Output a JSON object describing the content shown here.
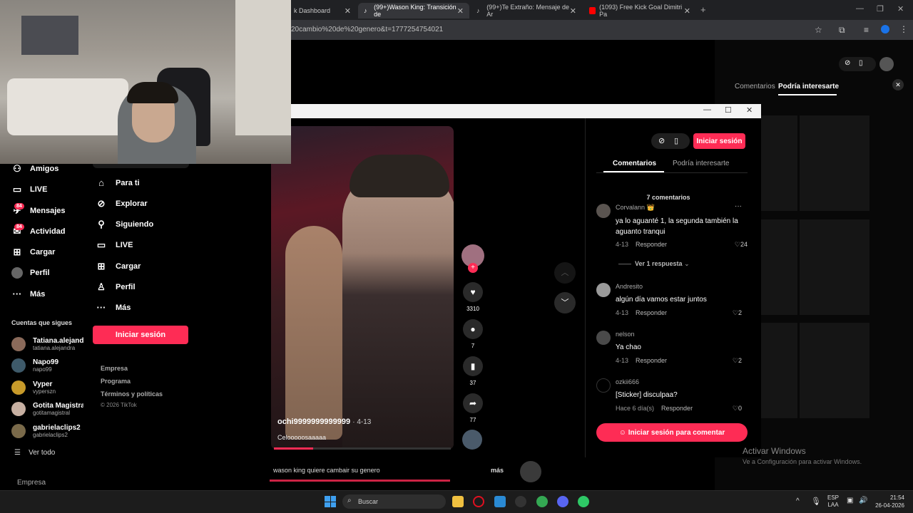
{
  "browser": {
    "tabs": [
      {
        "label": "k Dashboard"
      },
      {
        "label": "(99+)Wason King: Transición de"
      },
      {
        "label": "(99+)Te Extraño: Mensaje de Ar"
      },
      {
        "label": "(1093) Free Kick Goal Dimitri Pa"
      }
    ],
    "url": "20cambio%20de%20genero&t=1777254754021"
  },
  "sidebar": {
    "items": [
      {
        "label": "Amigos",
        "icon": "friends-icon"
      },
      {
        "label": "LIVE",
        "icon": "live-icon"
      },
      {
        "label": "Mensajes",
        "icon": "messages-icon",
        "badge": "84"
      },
      {
        "label": "Actividad",
        "icon": "activity-icon",
        "badge": "84"
      },
      {
        "label": "Cargar",
        "icon": "upload-icon"
      },
      {
        "label": "Perfil",
        "icon": "profile-icon"
      },
      {
        "label": "Más",
        "icon": "more-icon"
      }
    ],
    "following_title": "Cuentas que sigues",
    "following": [
      {
        "name": "Tatiana.alejandr",
        "handle": "tatiana.alejandra"
      },
      {
        "name": "Napo99",
        "handle": "napo99"
      },
      {
        "name": "Vyper",
        "handle": "vyperszn"
      },
      {
        "name": "Gotita Magistral",
        "handle": "gotitamagistral"
      },
      {
        "name": "gabrielaclips2",
        "handle": "gabrielaclips2"
      }
    ],
    "see_all": "Ver todo",
    "footer": "Empresa"
  },
  "menu": {
    "items": [
      {
        "label": "Para ti",
        "icon": "home-icon"
      },
      {
        "label": "Explorar",
        "icon": "compass-icon"
      },
      {
        "label": "Siguiendo",
        "icon": "following-icon"
      },
      {
        "label": "LIVE",
        "icon": "live-icon"
      },
      {
        "label": "Cargar",
        "icon": "upload-icon"
      },
      {
        "label": "Perfil",
        "icon": "profile-icon"
      },
      {
        "label": "Más",
        "icon": "more-icon"
      }
    ],
    "login": "Iniciar sesión",
    "links": [
      "Empresa",
      "Programa",
      "Términos y políticas",
      "© 2026 TikTok"
    ]
  },
  "video": {
    "author": "ochi9999999999999",
    "date": "· 4-13",
    "caption": "Celooooosaaaaa",
    "below_caption": "wason king quiere cambair su genero",
    "more": "más",
    "likes": "3310",
    "comments": "7",
    "saves": "37",
    "shares": "77"
  },
  "comments_panel": {
    "login": "Iniciar sesión",
    "tab_comments": "Comentarios",
    "tab_suggest": "Podría interesarte",
    "count": "7 comentarios",
    "comments": [
      {
        "user": "Corvalann 👑",
        "text": "ya lo aguanté 1, la segunda también la aguanto tranqui",
        "date": "4-13",
        "reply": "Responder",
        "likes": "24"
      },
      {
        "user": "Andresito",
        "text": "algún día vamos estar juntos",
        "date": "4-13",
        "reply": "Responder",
        "likes": "2"
      },
      {
        "user": "nelson",
        "text": "Ya chao",
        "date": "4-13",
        "reply": "Responder",
        "likes": "2"
      },
      {
        "user": "ozkii666",
        "text": "[Sticker] disculpaa?",
        "date": "Hace 6 día(s)",
        "reply": "Responder",
        "likes": "0"
      }
    ],
    "see_replies": "Ver 1 respuesta",
    "comment_login": "Iniciar sesión para comentar"
  },
  "bg_page": {
    "tab_comments": "Comentarios",
    "tab_suggest": "Podría interesarte"
  },
  "watermark": {
    "title": "Activar Windows",
    "subtitle": "Ve a Configuración para activar Windows."
  },
  "taskbar": {
    "search": "Buscar",
    "lang1": "ESP",
    "lang2": "LAA",
    "time": "21:54",
    "date": "26-04-2026"
  },
  "colors": {
    "accent": "#fe2c55"
  }
}
